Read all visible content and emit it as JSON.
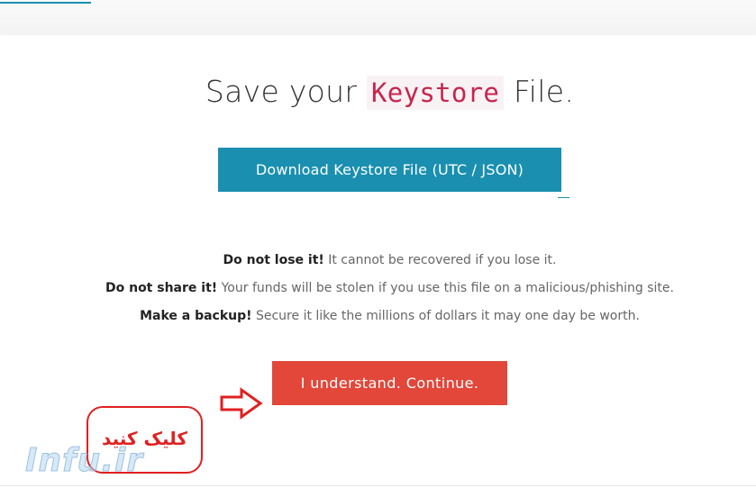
{
  "header": {
    "prefix": "Save your",
    "code_word": "Keystore",
    "suffix": "File."
  },
  "buttons": {
    "download_label": "Download Keystore File (UTC / JSON)",
    "continue_label": "I understand. Continue."
  },
  "warnings": [
    {
      "bold": "Do not lose it!",
      "text": " It cannot be recovered if you lose it."
    },
    {
      "bold": "Do not share it!",
      "text": " Your funds will be stolen if you use this file on a malicious/phishing site."
    },
    {
      "bold": "Make a backup!",
      "text": " Secure it like the millions of dollars it may one day be worth."
    }
  ],
  "annotation": {
    "bubble_text": "کلیک کنید",
    "watermark": "Infu.ir",
    "arrow_icon": "right-arrow-outline-icon"
  },
  "colors": {
    "accent_blue": "#1a8fb0",
    "continue_red": "#e2473a",
    "code_pink": "#c7254e",
    "annotation_red": "#e02020"
  }
}
